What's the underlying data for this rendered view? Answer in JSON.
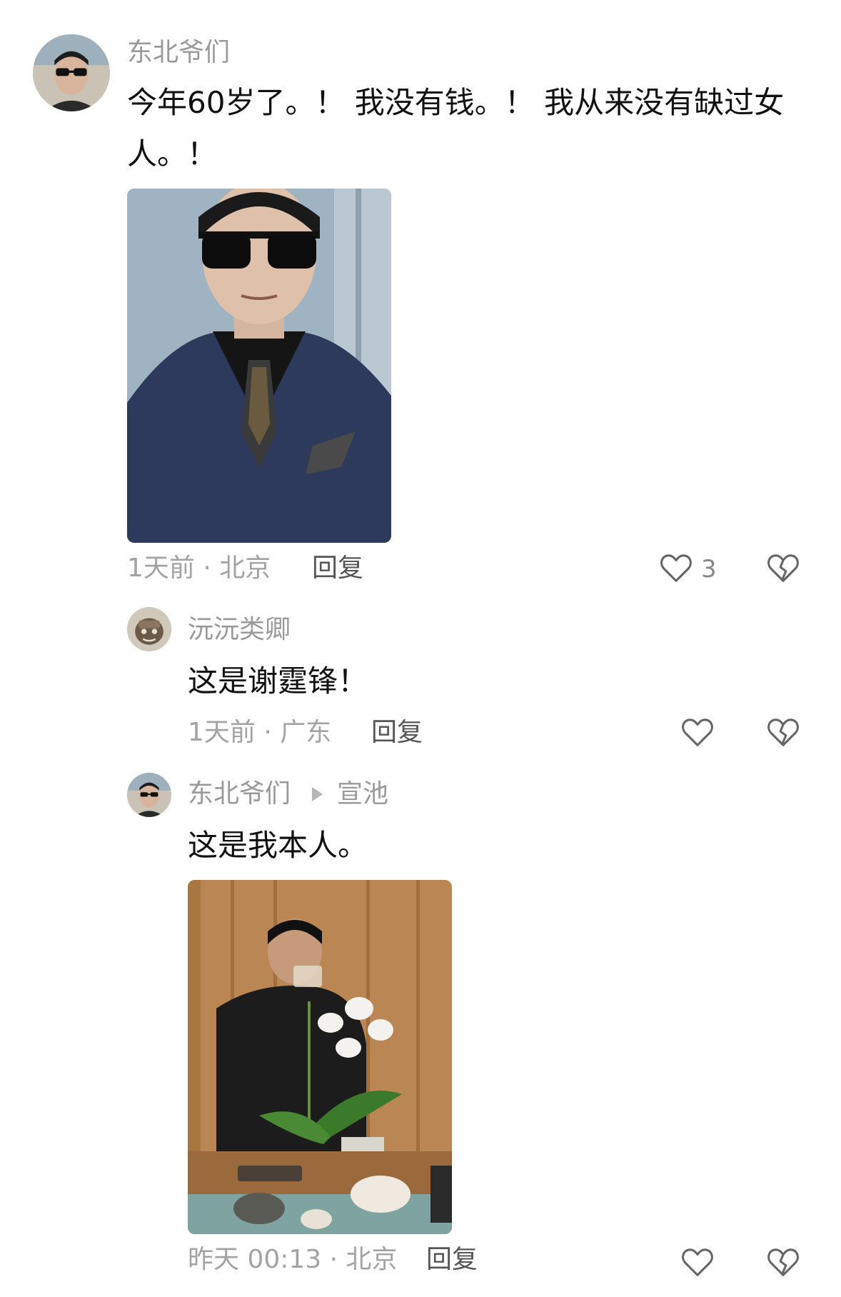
{
  "comment_main": {
    "username": "东北爷们",
    "text": "今年60岁了。！ 我没有钱。！ 我从来没有缺过女人。！",
    "meta": "1天前 · 北京",
    "reply_label": "回复",
    "like_count": "3"
  },
  "reply_1": {
    "username": "沅沅类卿",
    "text": "这是谢霆锋！",
    "meta": "1天前 · 广东",
    "reply_label": "回复"
  },
  "reply_2": {
    "username": "东北爷们",
    "reply_to": "宣池",
    "text": "这是我本人。",
    "meta": "昨天 00:13 · 北京",
    "reply_label": "回复"
  },
  "icons": {
    "like": "heart-outline-icon",
    "dislike": "broken-heart-icon"
  },
  "colors": {
    "text": "#111111",
    "secondary": "#a3a3a3",
    "reply": "#555555"
  }
}
